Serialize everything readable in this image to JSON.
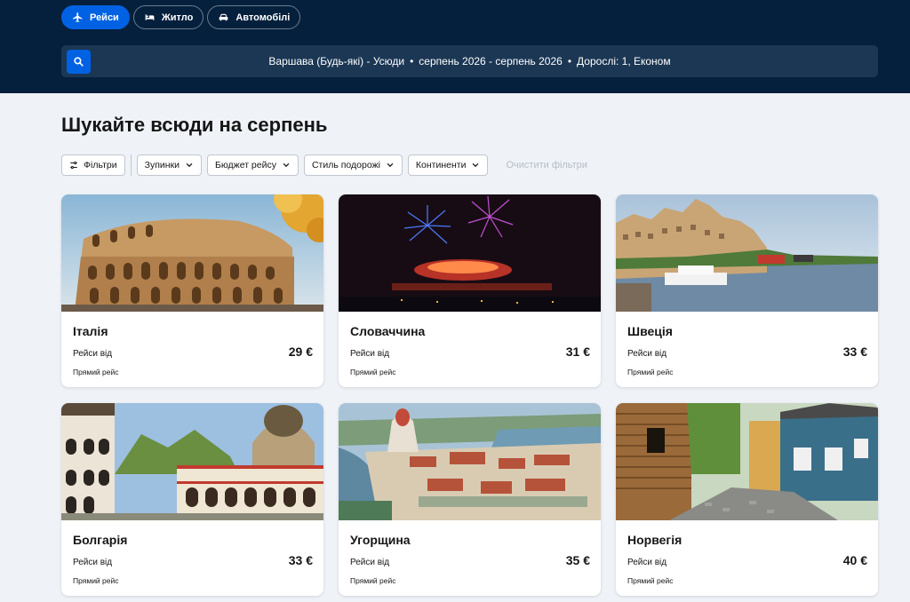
{
  "tabs": [
    {
      "label": "Рейси",
      "icon": "plane-icon",
      "active": true
    },
    {
      "label": "Житло",
      "icon": "bed-icon",
      "active": false
    },
    {
      "label": "Автомобілі",
      "icon": "car-icon",
      "active": false
    }
  ],
  "search": {
    "origin": "Варшава (Будь-які) - Усюди",
    "dates": "серпень 2026 - серпень 2026",
    "passengers": "Дорослі: 1, Економ",
    "separator": "•"
  },
  "page": {
    "title": "Шукайте всюди на серпень"
  },
  "filters": {
    "main": "Фільтри",
    "items": [
      "Зупинки",
      "Бюджет рейсу",
      "Стиль подорожі",
      "Континенти"
    ],
    "clear": "Очистити фільтри"
  },
  "cards": [
    {
      "country": "Італія",
      "from": "Рейси від",
      "price": "29 €",
      "direct": "Прямий рейс"
    },
    {
      "country": "Словаччина",
      "from": "Рейси від",
      "price": "31 €",
      "direct": "Прямий рейс"
    },
    {
      "country": "Швеція",
      "from": "Рейси від",
      "price": "33 €",
      "direct": "Прямий рейс"
    },
    {
      "country": "Болгарія",
      "from": "Рейси від",
      "price": "33 €",
      "direct": "Прямий рейс"
    },
    {
      "country": "Угорщина",
      "from": "Рейси від",
      "price": "35 €",
      "direct": "Прямий рейс"
    },
    {
      "country": "Норвегія",
      "from": "Рейси від",
      "price": "40 €",
      "direct": "Прямий рейс"
    }
  ],
  "colors": {
    "header": "#05203c",
    "accent": "#0062e3",
    "search_bar": "#1b3754"
  }
}
